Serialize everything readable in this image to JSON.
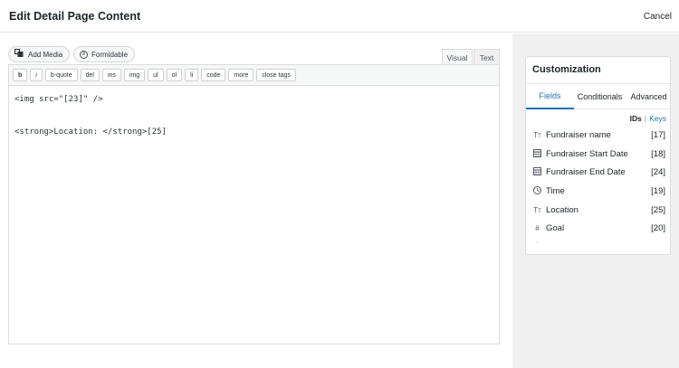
{
  "header": {
    "title": "Edit Detail Page Content",
    "cancel_label": "Cancel"
  },
  "media_buttons": [
    {
      "label": "Add Media",
      "icon": "add-media-icon"
    },
    {
      "label": "Formidable",
      "icon": "formidable-icon"
    }
  ],
  "mode_tabs": [
    "Visual",
    "Text"
  ],
  "toolbar": [
    "b",
    "i",
    "b-quote",
    "del",
    "ins",
    "img",
    "ul",
    "ol",
    "li",
    "code",
    "more",
    "close tags"
  ],
  "editor_lines": [
    "<img src=\"[23]\" />",
    "",
    "",
    "<strong>Location: </strong>[25]"
  ],
  "panel": {
    "title": "Customization",
    "tabs": [
      "Fields",
      "Conditionals",
      "Advanced"
    ],
    "ids_label": "IDs",
    "separator": "|",
    "keys_label": "Keys",
    "fields": [
      {
        "name": "Fundraiser name",
        "id": "[17]",
        "icon": "text-field-icon"
      },
      {
        "name": "Fundraiser Start Date",
        "id": "[18]",
        "icon": "calendar-icon"
      },
      {
        "name": "Fundraiser End Date",
        "id": "[24]",
        "icon": "calendar-icon"
      },
      {
        "name": "Time",
        "id": "[19]",
        "icon": "clock-icon"
      },
      {
        "name": "Location",
        "id": "[25]",
        "icon": "text-field-icon"
      },
      {
        "name": "Goal",
        "id": "[20]",
        "icon": "number-icon"
      }
    ]
  },
  "colors": {
    "accent": "#2271b1",
    "sidebar_bg": "#f0f0f1"
  }
}
